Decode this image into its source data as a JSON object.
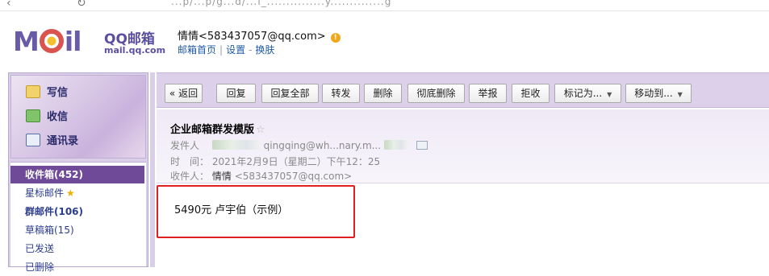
{
  "browser": {
    "nav_back": "‹",
    "nav_reload": "↻",
    "url_fragment": "...p/...p/g...d/...i_...............y..............g"
  },
  "header": {
    "logo_text": "M",
    "logo_text_end": "il",
    "brand": "QQ邮箱",
    "domain": "mail.qq.com",
    "user_name": "情情<583437057@qq.com>",
    "links": [
      "邮箱首页",
      "设置",
      "换肤"
    ]
  },
  "sidebar": {
    "quick": [
      {
        "label": "写信",
        "icon": "pencil-icon"
      },
      {
        "label": "收信",
        "icon": "inbox-download-icon"
      },
      {
        "label": "通讯录",
        "icon": "contact-card-icon"
      }
    ],
    "folders": [
      {
        "label": "收件箱(452)"
      },
      {
        "label": "星标邮件"
      },
      {
        "label": "群邮件(106)"
      },
      {
        "label": "草稿箱(15)"
      },
      {
        "label": "已发送"
      },
      {
        "label": "已删除"
      }
    ]
  },
  "toolbar": {
    "buttons": [
      "« 返回",
      "回复",
      "回复全部",
      "转发",
      "删除",
      "彻底删除",
      "举报",
      "拒收",
      "标记为...",
      "移动到..."
    ]
  },
  "mail": {
    "subject": "企业邮箱群发模版",
    "from_label": "发件人",
    "from_value": "qingqing@wh...nary.m...",
    "time_label": "时　间：",
    "time_value": "2021年2月9日（星期二）下午12：25",
    "to_label": "收件人：",
    "to_name": "情情",
    "to_addr": "<583437057@qq.com>",
    "body": "5490元  卢宇伯（示例）"
  },
  "colors": {
    "accent": "#6f4a99",
    "toolbar_bg": "#dcd0ea",
    "highlight": "#e02020"
  }
}
